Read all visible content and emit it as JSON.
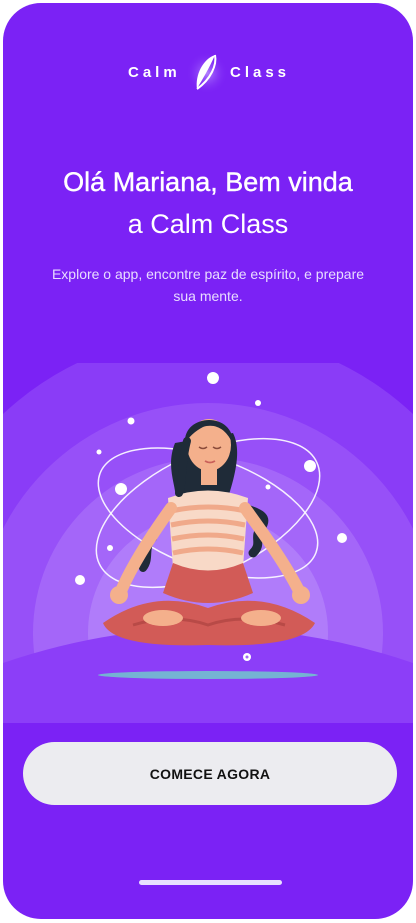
{
  "brand": {
    "left_word": "Calm",
    "right_word": "Class"
  },
  "welcome": {
    "line1": "Olá Mariana, Bem vinda",
    "line2": "a Calm Class",
    "subtitle": "Explore o app, encontre paz de espírito, e prepare sua mente."
  },
  "cta": {
    "label": "COMECE AGORA"
  },
  "colors": {
    "background": "#7b22f5",
    "button": "#ececf0",
    "accent_skin": "#f4b08c",
    "pants": "#d25b57"
  },
  "illustration": {
    "icon": "meditating-woman-illustration"
  }
}
